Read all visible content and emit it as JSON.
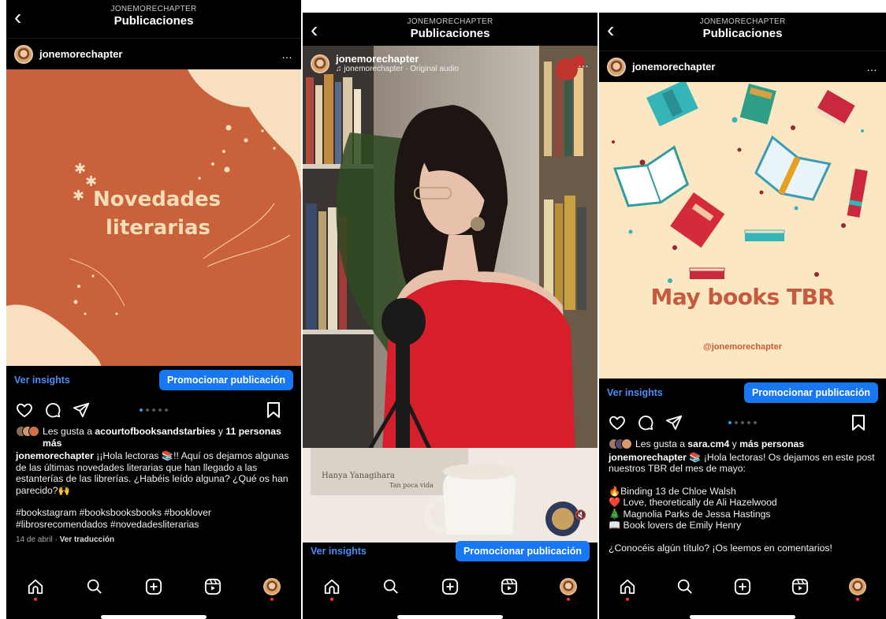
{
  "header": {
    "account": "JONEMORECHAPTER",
    "title": "Publicaciones",
    "back_icon": "chevron-left-icon"
  },
  "username": "jonemorechapter",
  "more_glyph": "…",
  "insights_label": "Ver insights",
  "promote_label": "Promocionar publicación",
  "colors": {
    "promote": "#1877f2",
    "insights": "#4a8df8",
    "notification_dot": "#ff3040"
  },
  "post1": {
    "art_title_line1": "Novedades",
    "art_title_line2": "literarias",
    "carousel_count": 5,
    "carousel_active": 0,
    "likes_prefix": "Les gusta a ",
    "likes_user": "acourtofbooksandstarbies",
    "likes_suffix_pre": " y ",
    "likes_count": "11 personas más",
    "caption_text": "¡¡Hola lectoras 📚!! Aquí os dejamos algunas de las últimas novedades literarias que han llegado a las estanterías de las librerías. ¿Habéis leído alguna? ¿Qué os han parecido?🙌",
    "hashtags": "#bookstagram #booksbooksbooks #booklover #librosrecomendados #novedadesliterarias",
    "date": "14 de abril",
    "translate": "Ver traducción"
  },
  "post2": {
    "audio_label": "jonemorechapter · Original audio",
    "book_title": "Hanya Yanagihara",
    "book_subtitle": "Tan poca vida"
  },
  "post3": {
    "art_title": "May books TBR",
    "art_handle": "@jonemorechapter",
    "carousel_count": 5,
    "carousel_active": 0,
    "likes_prefix": "Les gusta a ",
    "likes_user": "sara.cm4",
    "likes_mid": " y ",
    "likes_rest": "más personas",
    "caption_text": "📚 ¡Hola lectoras! Os dejamos en este post nuestros TBR del mes de mayo:",
    "list": [
      "🔥Binding 13 de Chloe Walsh",
      "❤️ Love, theoretically de Ali Hazelwood",
      "🎄 Magnolia Parks de Jessa Hastings",
      "📖 Book lovers de Emily Henry"
    ],
    "closing": "¿Conocéis algún título? ¡Os leemos en comentarios!"
  },
  "nav": [
    "home-icon",
    "search-icon",
    "create-icon",
    "reels-icon",
    "profile-avatar"
  ]
}
